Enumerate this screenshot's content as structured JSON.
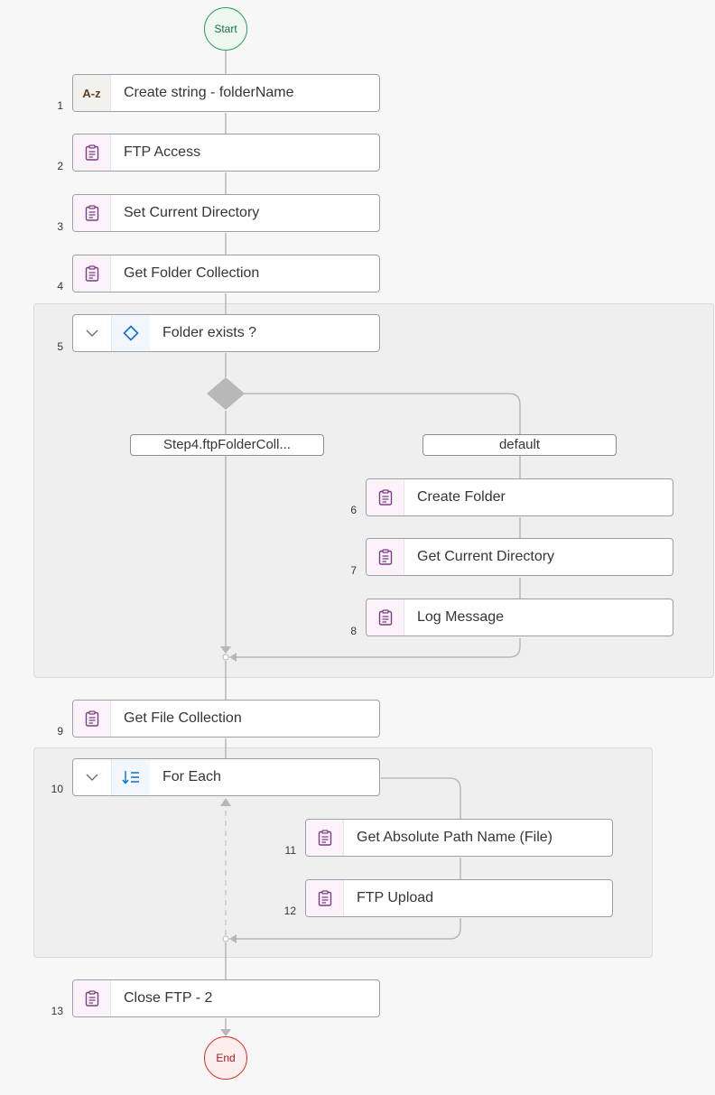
{
  "start_label": "Start",
  "end_label": "End",
  "steps": [
    {
      "num": "1",
      "label": "Create string - folderName",
      "icon": "string-icon",
      "icon_text": "A-z"
    },
    {
      "num": "2",
      "label": "FTP Access",
      "icon": "clipboard-icon"
    },
    {
      "num": "3",
      "label": "Set Current Directory",
      "icon": "clipboard-icon"
    },
    {
      "num": "4",
      "label": "Get Folder Collection",
      "icon": "clipboard-icon"
    },
    {
      "num": "5",
      "label": "Folder exists ?",
      "icon": "diamond-icon"
    },
    {
      "num": "6",
      "label": "Create Folder",
      "icon": "clipboard-icon"
    },
    {
      "num": "7",
      "label": "Get Current Directory",
      "icon": "clipboard-icon"
    },
    {
      "num": "8",
      "label": "Log Message",
      "icon": "clipboard-icon"
    },
    {
      "num": "9",
      "label": "Get File Collection",
      "icon": "clipboard-icon"
    },
    {
      "num": "10",
      "label": "For Each",
      "icon": "loop-icon"
    },
    {
      "num": "11",
      "label": "Get Absolute Path Name (File)",
      "icon": "clipboard-icon"
    },
    {
      "num": "12",
      "label": "FTP Upload",
      "icon": "clipboard-icon"
    },
    {
      "num": "13",
      "label": "Close FTP - 2",
      "icon": "clipboard-icon"
    }
  ],
  "branches": {
    "left_condition": "Step4.ftpFolderColl...",
    "right_condition": "default"
  },
  "colors": {
    "start": "#2b9a5b",
    "end": "#d0312d",
    "activity_icon": "#7d3c86",
    "control_icon": "#0a6ed1",
    "connector": "#b8b8b8"
  }
}
